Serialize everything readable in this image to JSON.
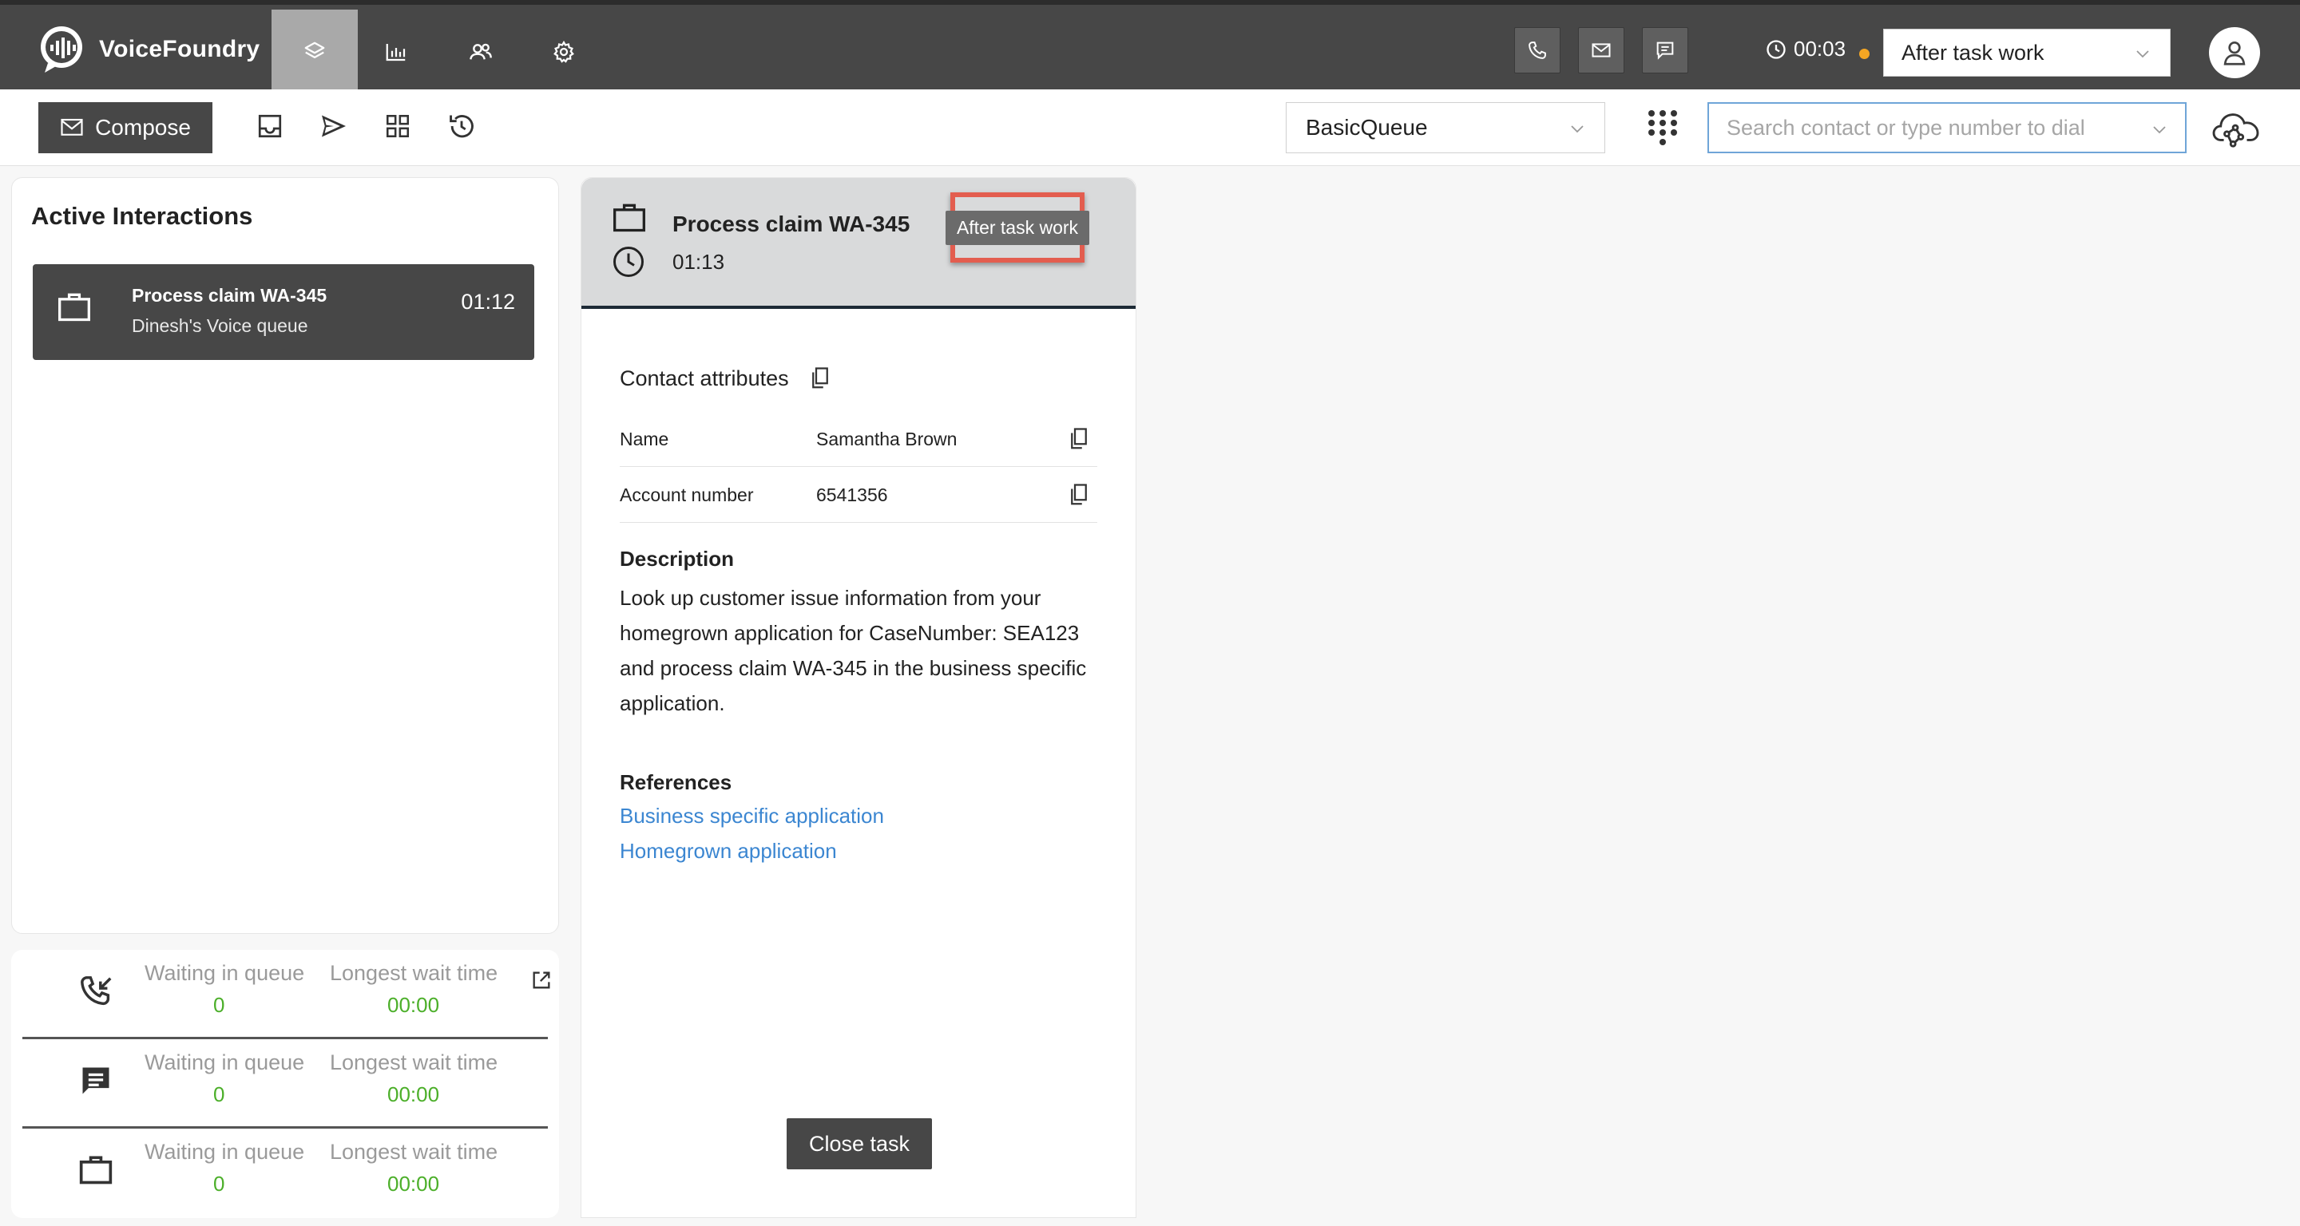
{
  "app": {
    "name": "VoiceFoundry",
    "timer": "00:03",
    "status": "After task work",
    "colors": {
      "topbar": "#474747",
      "accent_green": "#4caf2a",
      "link": "#3b86d1",
      "highlight": "#e35d4f",
      "status_dot": "#f5a623"
    }
  },
  "nav": {
    "items": [
      {
        "icon": "layers-icon",
        "active": true
      },
      {
        "icon": "bar-chart-icon",
        "active": false
      },
      {
        "icon": "users-icon",
        "active": false
      },
      {
        "icon": "gear-icon",
        "active": false
      }
    ]
  },
  "channels": [
    "phone-icon",
    "mail-icon",
    "chat-icon"
  ],
  "toolbar": {
    "compose_label": "Compose",
    "queue": "BasicQueue",
    "search_placeholder": "Search contact or type number to dial"
  },
  "active_interactions": {
    "title": "Active Interactions",
    "items": [
      {
        "title": "Process claim WA-345",
        "queue": "Dinesh's Voice queue",
        "time": "01:12"
      }
    ]
  },
  "queue_stats": [
    {
      "channel": "voice",
      "waiting_label": "Waiting in queue",
      "waiting": "0",
      "longest_label": "Longest wait time",
      "longest": "00:00"
    },
    {
      "channel": "chat",
      "waiting_label": "Waiting in queue",
      "waiting": "0",
      "longest_label": "Longest wait time",
      "longest": "00:00"
    },
    {
      "channel": "task",
      "waiting_label": "Waiting in queue",
      "waiting": "0",
      "longest_label": "Longest wait time",
      "longest": "00:00"
    }
  ],
  "task": {
    "title": "Process claim WA-345",
    "time": "01:13",
    "badge": "After task work",
    "attributes_title": "Contact attributes",
    "attributes": [
      {
        "key": "Name",
        "value": "Samantha Brown"
      },
      {
        "key": "Account number",
        "value": "6541356"
      }
    ],
    "description_title": "Description",
    "description": "Look up customer issue information from your homegrown application for CaseNumber: SEA123 and process claim WA-345 in the business specific application.",
    "references_title": "References",
    "references": [
      "Business specific application",
      "Homegrown application"
    ],
    "close_label": "Close task"
  }
}
